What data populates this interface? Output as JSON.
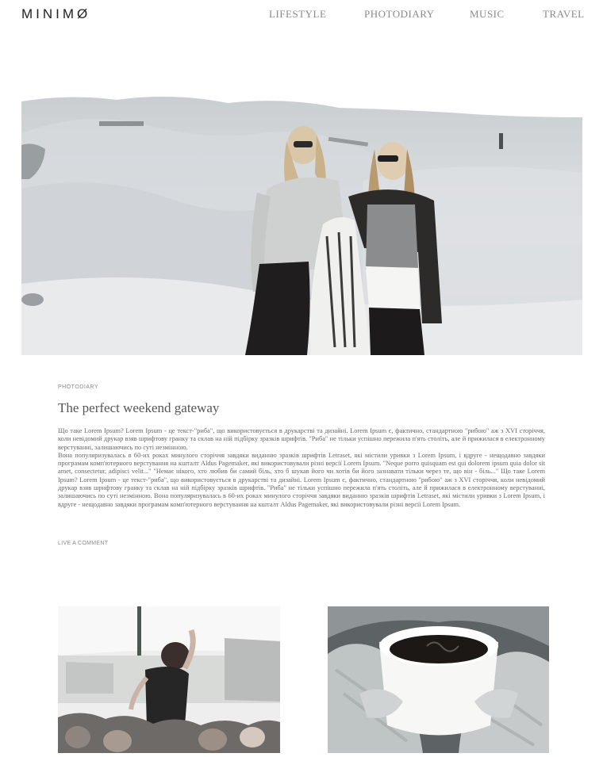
{
  "header": {
    "logo": "MINIMØ",
    "nav": [
      "LIFESTYLE",
      "PHOTODIARY",
      "MUSIC",
      "TRAVEL"
    ]
  },
  "post": {
    "category": "PHOTODIARY",
    "title": "The perfect weekend gateway",
    "paragraphs": [
      "Що таке Lorem Ipsum? Lorem Ipsum - це текст-\"риба\", що використовується в друкарстві та дизайні. Lorem Ipsum є, фактично, стандартною \"рибою\" аж з XVI сторіччя, коли невідомий друкар взяв шрифтову гранку та склав на ній підбірку зразків шрифтів. \"Риба\" не тільки успішно пережила п'ять століть, але й прижилася в електронному верстуванні, залишаючись по суті незмінною.",
      "Вона популяризувалась в 60-их роках минулого сторіччя завдяки виданню зразків шрифтів Letraset, які містили уривки з Lorem Ipsum, і вдруге - нещодавно завдяки програмам комп'ютерного верстування на кшталт Aldus Pagemaker, які використовували різні версії Lorem Ipsum. \"Neque porro quisquam est qui dolorem ipsum quia dolor sit amet, consectetur, adipisci velit...\" \"Немає нікого, хто любив би самий біль, хто б шукав його чи хотів би його зазнавати тільки через те, що він - біль...\" Що таке Lorem Ipsum? Lorem Ipsum - це текст-\"риба\", що використовується в друкарстві та дизайні. Lorem Ipsum є, фактично, стандартною \"рибою\" аж з XVI сторіччя, коли невідомий друкар взяв шрифтову гранку та склав на ній підбірку зразків шрифтів. \"Риба\" не тільки успішно пережила п'ять століть, але й прижилася в електронному верстуванні, залишаючись по суті незмінною. Вона популяризувалась в 60-их роках минулого сторіччя завдяки виданню зразків шрифтів Letraset, які містили уривки з Lorem Ipsum, і вдруге - нещодавно завдяки програмам комп'ютерного верстування на кшталт Aldus Pagemaker, які використовували різні версії Lorem Ipsum."
    ],
    "comment_link": "LIVE A COMMENT"
  },
  "colors": {
    "logo": "#222222",
    "nav": "#8a8a8a",
    "text": "#666666"
  }
}
